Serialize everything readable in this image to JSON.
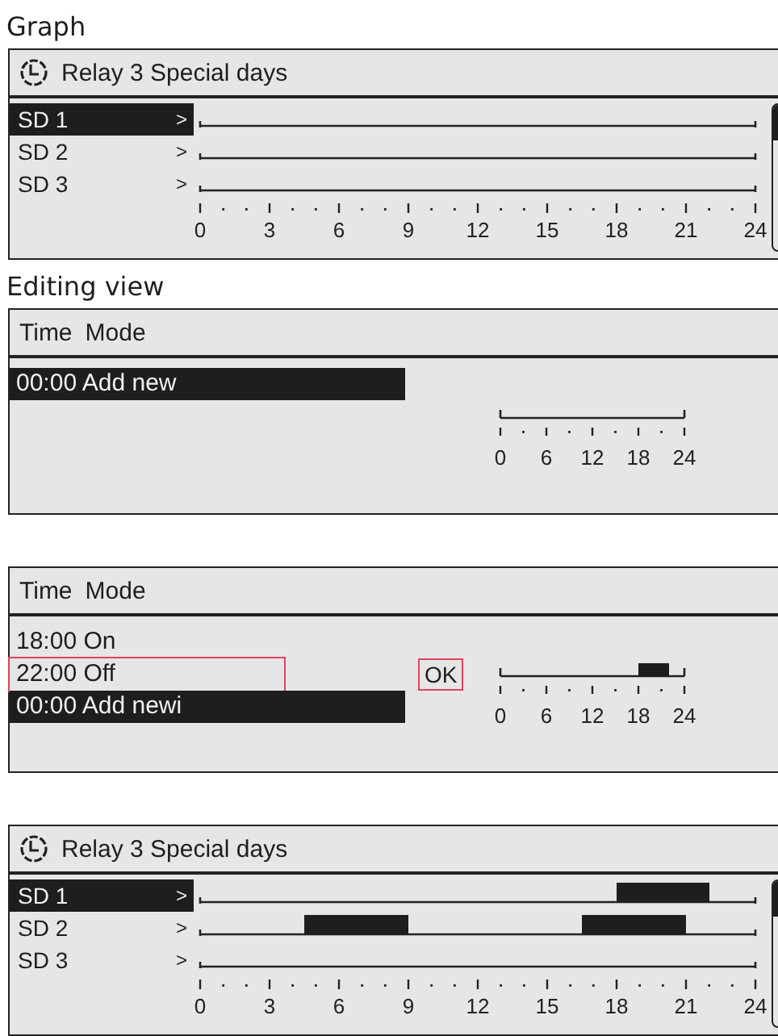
{
  "sections": [
    {
      "kind": "graph",
      "caption": "Graph",
      "title": "Relay 3 Special days",
      "rows": [
        {
          "label": "SD 1",
          "arrow": ">",
          "selected": true,
          "half_hours_on": [
            false,
            false,
            false,
            false,
            false,
            false,
            false,
            false,
            false,
            false,
            false,
            false,
            false,
            false,
            false,
            false,
            false,
            false,
            false,
            false,
            false,
            false,
            false,
            false,
            false,
            false,
            false,
            false,
            false,
            false,
            false,
            false,
            false,
            false,
            false,
            false,
            false,
            false,
            false,
            false,
            false,
            false,
            false,
            false,
            false,
            false,
            false,
            false
          ]
        },
        {
          "label": "SD 2",
          "arrow": ">",
          "selected": false,
          "half_hours_on": [
            false,
            false,
            false,
            false,
            false,
            false,
            false,
            false,
            false,
            false,
            false,
            false,
            false,
            false,
            false,
            false,
            false,
            false,
            false,
            false,
            false,
            false,
            false,
            false,
            false,
            false,
            false,
            false,
            false,
            false,
            false,
            false,
            false,
            false,
            false,
            false,
            false,
            false,
            false,
            false,
            false,
            false,
            false,
            false,
            false,
            false,
            false,
            false
          ]
        },
        {
          "label": "SD 3",
          "arrow": ">",
          "selected": false,
          "half_hours_on": [
            false,
            false,
            false,
            false,
            false,
            false,
            false,
            false,
            false,
            false,
            false,
            false,
            false,
            false,
            false,
            false,
            false,
            false,
            false,
            false,
            false,
            false,
            false,
            false,
            false,
            false,
            false,
            false,
            false,
            false,
            false,
            false,
            false,
            false,
            false,
            false,
            false,
            false,
            false,
            false,
            false,
            false,
            false,
            false,
            false,
            false,
            false,
            false
          ]
        }
      ],
      "axis_labels": [
        "0",
        "3",
        "6",
        "9",
        "12",
        "15",
        "18",
        "21",
        "24"
      ]
    },
    {
      "kind": "editor",
      "caption": "Editing view",
      "columns": [
        "Time",
        "Mode"
      ],
      "entries": [
        {
          "text": "00:00 Add new",
          "selected": true,
          "highlighted": false
        }
      ],
      "half_hours_on": [
        false,
        false,
        false,
        false,
        false,
        false,
        false,
        false,
        false,
        false,
        false,
        false,
        false,
        false,
        false,
        false,
        false,
        false,
        false,
        false,
        false,
        false,
        false,
        false,
        false,
        false,
        false,
        false,
        false,
        false,
        false,
        false,
        false,
        false,
        false,
        false,
        false,
        false,
        false,
        false,
        false,
        false,
        false,
        false,
        false,
        false,
        false,
        false
      ],
      "axis_labels": [
        "0",
        "6",
        "12",
        "18",
        "24"
      ]
    },
    {
      "kind": "editor",
      "columns": [
        "Time",
        "Mode"
      ],
      "entries": [
        {
          "text": "18:00  On",
          "selected": false,
          "highlighted": false
        },
        {
          "text": "22:00 Off",
          "selected": false,
          "highlighted": true
        },
        {
          "text": "00:00 Add newi",
          "selected": true,
          "highlighted": false
        }
      ],
      "ok_button": {
        "label": "OK",
        "highlighted": true
      },
      "half_hours_on": [
        false,
        false,
        false,
        false,
        false,
        false,
        false,
        false,
        false,
        false,
        false,
        false,
        false,
        false,
        false,
        false,
        false,
        false,
        false,
        false,
        false,
        false,
        false,
        false,
        false,
        false,
        false,
        false,
        false,
        false,
        false,
        false,
        false,
        false,
        false,
        false,
        true,
        true,
        true,
        true,
        true,
        true,
        true,
        true,
        false,
        false,
        false,
        false
      ],
      "axis_labels": [
        "0",
        "6",
        "12",
        "18",
        "24"
      ]
    },
    {
      "kind": "graph",
      "title": "Relay 3 Special days",
      "rows": [
        {
          "label": "SD 1",
          "arrow": ">",
          "selected": true,
          "half_hours_on": [
            false,
            false,
            false,
            false,
            false,
            false,
            false,
            false,
            false,
            false,
            false,
            false,
            false,
            false,
            false,
            false,
            false,
            false,
            false,
            false,
            false,
            false,
            false,
            false,
            false,
            false,
            false,
            false,
            false,
            false,
            false,
            false,
            false,
            false,
            false,
            false,
            true,
            true,
            true,
            true,
            true,
            true,
            true,
            true,
            false,
            false,
            false,
            false
          ]
        },
        {
          "label": "SD 2",
          "arrow": ">",
          "selected": false,
          "half_hours_on": [
            false,
            false,
            false,
            false,
            false,
            false,
            false,
            false,
            false,
            true,
            true,
            true,
            true,
            true,
            true,
            true,
            true,
            true,
            false,
            false,
            false,
            false,
            false,
            false,
            false,
            false,
            false,
            false,
            false,
            false,
            false,
            false,
            false,
            true,
            true,
            true,
            true,
            true,
            true,
            true,
            true,
            true,
            false,
            false,
            false,
            false,
            false,
            false
          ]
        },
        {
          "label": "SD 3",
          "arrow": ">",
          "selected": false,
          "half_hours_on": [
            false,
            false,
            false,
            false,
            false,
            false,
            false,
            false,
            false,
            false,
            false,
            false,
            false,
            false,
            false,
            false,
            false,
            false,
            false,
            false,
            false,
            false,
            false,
            false,
            false,
            false,
            false,
            false,
            false,
            false,
            false,
            false,
            false,
            false,
            false,
            false,
            false,
            false,
            false,
            false,
            false,
            false,
            false,
            false,
            false,
            false,
            false,
            false
          ]
        }
      ],
      "axis_labels": [
        "0",
        "3",
        "6",
        "9",
        "12",
        "15",
        "18",
        "21",
        "24"
      ]
    }
  ]
}
